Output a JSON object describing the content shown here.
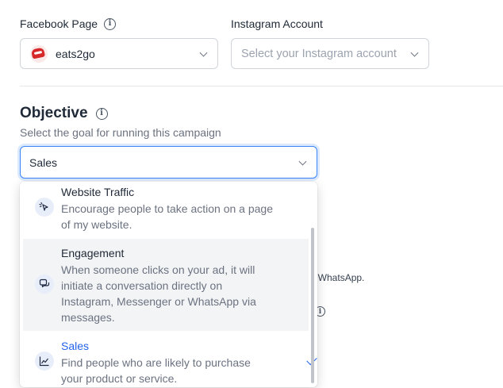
{
  "facebook_page": {
    "label": "Facebook Page",
    "value": "eats2go"
  },
  "instagram_account": {
    "label": "Instagram Account",
    "placeholder": "Select your Instagram account"
  },
  "objective": {
    "title": "Objective",
    "subtitle": "Select the goal for running this campaign",
    "selected": "Sales",
    "options": [
      {
        "title": "Website Traffic",
        "description": "Encourage people to take action on a page of my website.",
        "icon": "cursor-click-icon"
      },
      {
        "title": "Engagement",
        "description": "When someone clicks on your ad, it will initiate a conversation directly on Instagram, Messenger or WhatsApp via messages.",
        "icon": "chat-icon"
      },
      {
        "title": "Sales",
        "description": "Find people who are likely to purchase your product or service.",
        "icon": "trend-chart-icon"
      }
    ]
  },
  "background": {
    "partial_text": "nd WhatsApp."
  },
  "colors": {
    "accent": "#2563eb",
    "focus_ring": "#3b82f6",
    "highlight": "#f3f4f6"
  }
}
